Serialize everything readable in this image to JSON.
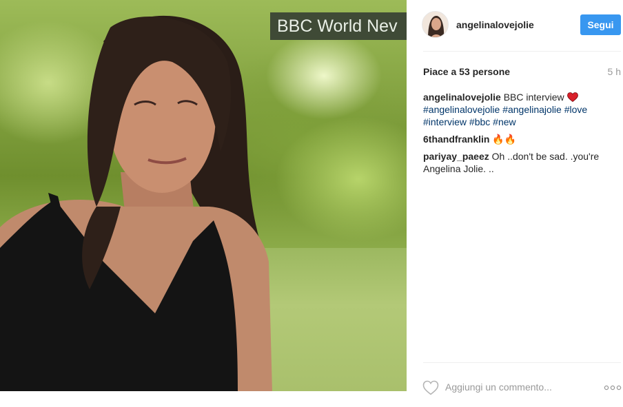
{
  "post": {
    "photo": {
      "overlay_text": "BBC World Nev"
    },
    "header": {
      "username": "angelinalovejolie",
      "follow_label": "Segui"
    },
    "likes_text": "Piace a 53 persone",
    "time_ago": "5 h",
    "caption": {
      "user": "angelinalovejolie",
      "text": "BBC interview",
      "emoji": "❤️",
      "hashtags": [
        "#angelinalovejolie",
        "#angelinajolie",
        "#love",
        "#interview",
        "#bbc",
        "#new"
      ]
    },
    "comments": [
      {
        "user": "6thandfranklin",
        "text": "🔥🔥"
      },
      {
        "user": "pariyay_paeez",
        "text": "Oh ..don't be sad. .you're Angelina Jolie. .."
      }
    ],
    "actions": {
      "comment_placeholder": "Aggiungi un commento...",
      "like_icon": "heart-outline-icon",
      "more_icon": "ellipsis-icon"
    },
    "colors": {
      "follow_button": "#3897f0",
      "hashtag": "#003569",
      "muted": "#999999",
      "heart_emoji": "#ed4956"
    }
  }
}
